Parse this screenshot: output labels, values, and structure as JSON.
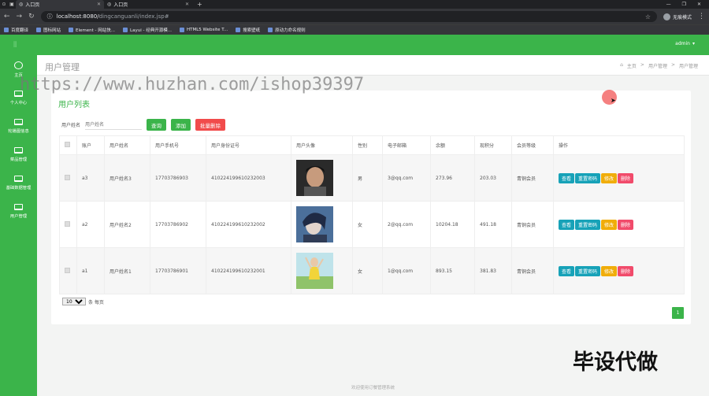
{
  "browser": {
    "tabs": [
      {
        "label": "入口页",
        "active": true
      },
      {
        "label": "入口页",
        "active": false
      }
    ],
    "url_host": "localhost:8080/",
    "url_path": "dingcanguanli/index.jsp#",
    "profile_label": "无痕模式",
    "bookmarks": [
      "百度翻译",
      "图标网站",
      "Element - 网站快...",
      "Layui - 经典开源模...",
      "HTML5 Website T...",
      "搜索壁纸",
      "原动力命名规则"
    ]
  },
  "app": {
    "user": "admin",
    "sidebar": [
      {
        "label": "主页",
        "icon": "dashboard-icon"
      },
      {
        "label": "个人中心",
        "icon": "monitor-icon"
      },
      {
        "label": "轮播图信息",
        "icon": "monitor-icon"
      },
      {
        "label": "菜品管理",
        "icon": "monitor-icon"
      },
      {
        "label": "基础数据管理",
        "icon": "monitor-icon"
      },
      {
        "label": "用户管理",
        "icon": "monitor-icon"
      }
    ],
    "page_title": "用户管理",
    "breadcrumb": {
      "home": "主页",
      "sep": ">",
      "level1": "用户管理",
      "level2": "用户管理"
    },
    "panel_title": "用户列表",
    "search": {
      "label": "用户姓名",
      "placeholder": "用户姓名",
      "query_btn": "查询",
      "add_btn": "添加",
      "batch_delete_btn": "批量删除"
    },
    "table": {
      "headers": [
        "账户",
        "用户姓名",
        "用户手机号",
        "用户身份证号",
        "用户头像",
        "性别",
        "电子邮箱",
        "余额",
        "现积分",
        "会员等级",
        "操作"
      ],
      "rows": [
        {
          "account": "a3",
          "name": "用户姓名3",
          "phone": "17703786903",
          "id_card": "410224199610232003",
          "gender": "男",
          "email": "3@qq.com",
          "balance": "273.96",
          "points": "203.03",
          "level": "青铜会员"
        },
        {
          "account": "a2",
          "name": "用户姓名2",
          "phone": "17703786902",
          "id_card": "410224199610232002",
          "gender": "女",
          "email": "2@qq.com",
          "balance": "10204.18",
          "points": "491.18",
          "level": "青铜会员"
        },
        {
          "account": "a1",
          "name": "用户姓名1",
          "phone": "17703786901",
          "id_card": "410224199610232001",
          "gender": "女",
          "email": "1@qq.com",
          "balance": "893.15",
          "points": "381.83",
          "level": "青铜会员"
        }
      ],
      "ops": {
        "view": "查看",
        "reset": "重置密码",
        "edit": "修改",
        "delete": "删除"
      }
    },
    "pager": {
      "page_size": "10",
      "per_page_label": "条 每页",
      "current_page": "1"
    },
    "footer": "欢迎使用订餐管理系统"
  },
  "overlays": {
    "watermark_url": "https://www.huzhan.com/ishop39397",
    "watermark_cn": "毕设代做"
  },
  "colors": {
    "brand": "#3bb44a",
    "danger": "#f14b4b",
    "info": "#17a2b8",
    "warning": "#f0ad0a"
  }
}
